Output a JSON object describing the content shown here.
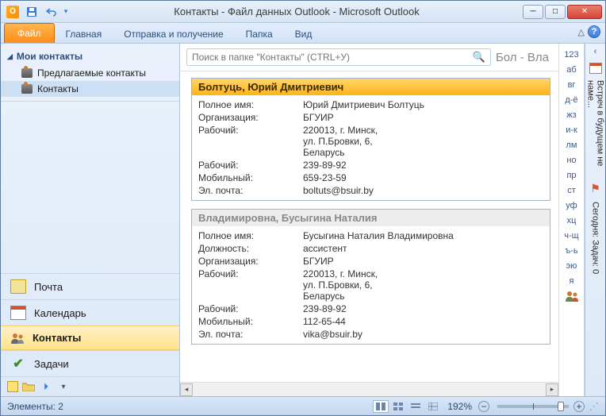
{
  "window": {
    "title": "Контакты - Файл данных Outlook  -  Microsoft Outlook"
  },
  "ribbon": {
    "file": "Файл",
    "tabs": [
      "Главная",
      "Отправка и получение",
      "Папка",
      "Вид"
    ]
  },
  "leftnav": {
    "header": "Мои контакты",
    "items": [
      {
        "label": "Предлагаемые контакты"
      },
      {
        "label": "Контакты"
      }
    ],
    "modules": {
      "mail": "Почта",
      "calendar": "Календарь",
      "contacts": "Контакты",
      "tasks": "Задачи"
    }
  },
  "search": {
    "placeholder": "Поиск в папке \"Контакты\" (CTRL+У)",
    "range_label": "Бол - Вла"
  },
  "field_labels": {
    "fullname": "Полное имя:",
    "org": "Организация:",
    "position": "Должность:",
    "work_addr": "Рабочий:",
    "work_phone": "Рабочий:",
    "mobile": "Мобильный:",
    "email": "Эл. почта:"
  },
  "contacts": [
    {
      "header": "Болтуць, Юрий Дмитриевич",
      "selected": true,
      "fullname": "Юрий Дмитриевич Болтуць",
      "org": "БГУИР",
      "work_addr": "220013, г. Минск,\nул. П.Бровки, 6,\nБеларусь",
      "work_phone": "239-89-92",
      "mobile": "659-23-59",
      "email": "boltuts@bsuir.by"
    },
    {
      "header": "Владимировна, Бусыгина Наталия",
      "selected": false,
      "fullname": "Бусыгина Наталия Владимировна",
      "position": "ассистент",
      "org": "БГУИР",
      "work_addr": "220013, г. Минск,\nул. П.Бровки, 6,\nБеларусь",
      "work_phone": "239-89-92",
      "mobile": "112-65-44",
      "email": "vika@bsuir.by"
    }
  ],
  "alphabet": [
    "123",
    "аб",
    "вг",
    "д-ё",
    "жз",
    "и-к",
    "лм",
    "но",
    "пр",
    "ст",
    "уф",
    "хц",
    "ч-щ",
    "ъ-ь",
    "эю",
    "я"
  ],
  "todobar": {
    "line1": "Встреч в будущем не наме...",
    "line2": "Сегодня: Задач: 0"
  },
  "statusbar": {
    "count_label": "Элементы: 2",
    "zoom": "192%"
  }
}
